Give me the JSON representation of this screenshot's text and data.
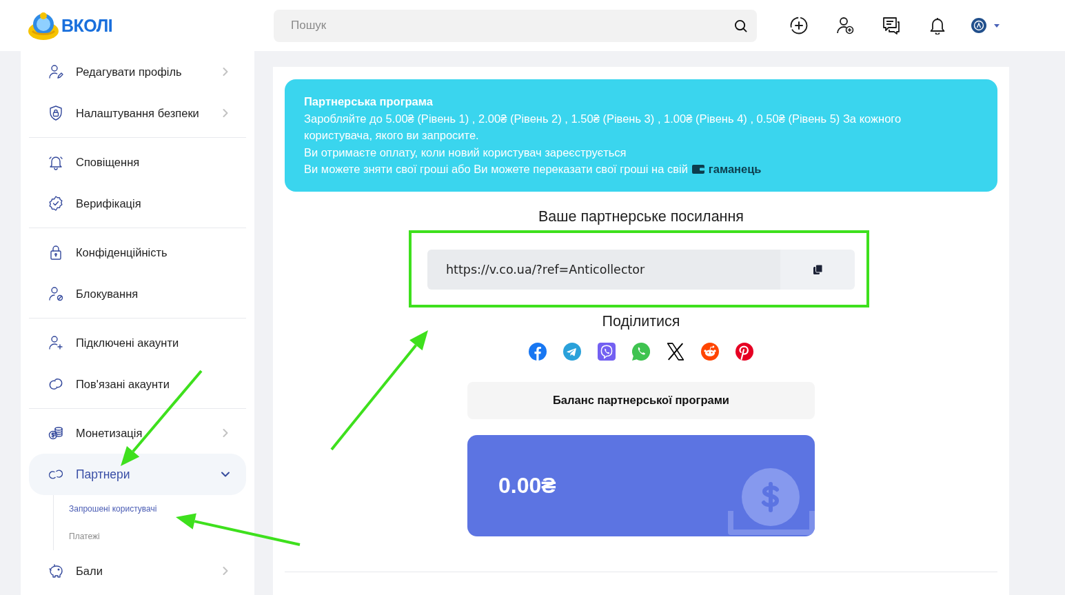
{
  "header": {
    "logo": "ВКОЛІ",
    "search": {
      "placeholder": "Пошук"
    }
  },
  "sidebar": {
    "groups": [
      {
        "items": [
          {
            "label": "Редагувати профіль",
            "selected": false,
            "expanded": false
          },
          {
            "label": "Налаштування безпеки",
            "selected": false,
            "expanded": false
          }
        ]
      },
      {
        "items": [
          {
            "label": "Сповіщення",
            "selected": false
          },
          {
            "label": "Верифікація",
            "selected": false
          }
        ]
      },
      {
        "items": [
          {
            "label": "Конфіденційність",
            "selected": false
          },
          {
            "label": "Блокування",
            "selected": false
          }
        ]
      },
      {
        "items": [
          {
            "label": "Підключені акаунти",
            "selected": false
          },
          {
            "label": "Пов'язані акаунти",
            "selected": false
          }
        ]
      },
      {
        "items": [
          {
            "label": "Монетизація",
            "selected": false,
            "expanded": false
          },
          {
            "label": "Партнери",
            "selected": true,
            "expanded": true,
            "children": [
              {
                "label": "Запрошені користувачі",
                "selected": true
              },
              {
                "label": "Платежі",
                "selected": false
              }
            ]
          },
          {
            "label": "Бали",
            "selected": false,
            "expanded": false
          }
        ]
      }
    ]
  },
  "info": {
    "title": "Партнерська програма",
    "lines": [
      "Заробляйте до 5.00₴ (Рівень 1) , 2.00₴ (Рівень 2) , 1.50₴ (Рівень 3) , 1.00₴ (Рівень 4) , 0.50₴ (Рівень 5) За кожного користувача, якого ви запросите.",
      "Ви отримаєте оплату, коли новий користувач зареєструється"
    ],
    "wallet_line": {
      "text": "Ви можете зняти свої гроші або Ви можете переказати свої гроші на свій",
      "link": "гаманець"
    }
  },
  "referral": {
    "title": "Ваше партнерське посилання",
    "link": "https://v.co.ua/?ref=Anticollector"
  },
  "share": {
    "title": "Поділитися"
  },
  "balance": {
    "title": "Баланс партнерської програми",
    "amount": "0.00₴"
  }
}
